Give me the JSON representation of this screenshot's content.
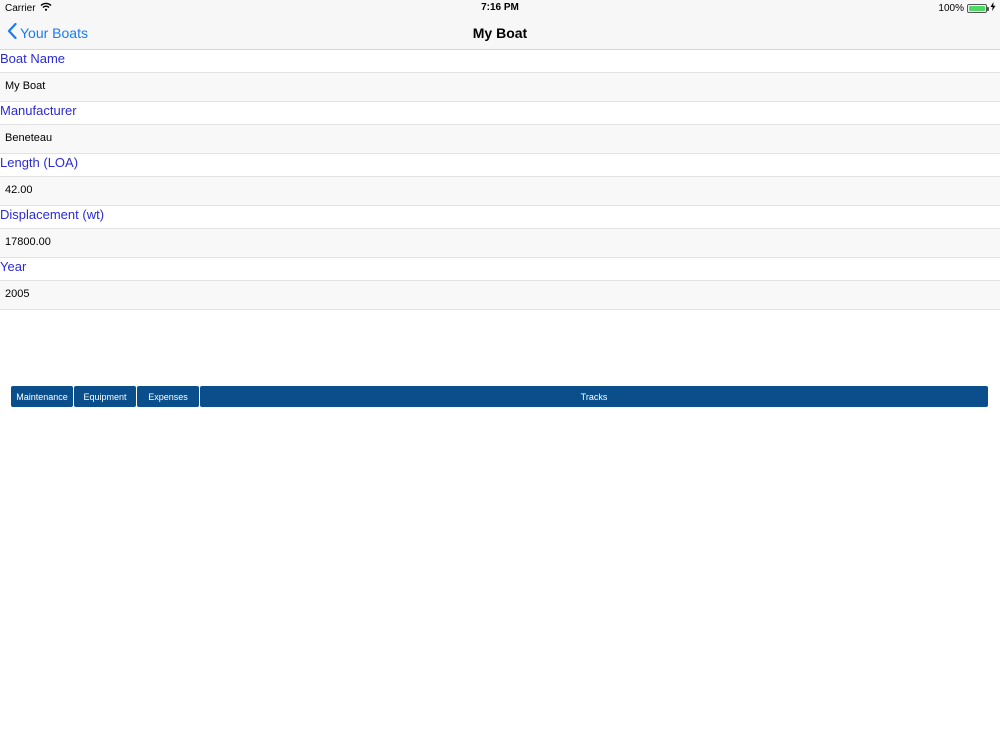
{
  "status_bar": {
    "carrier": "Carrier",
    "time": "7:16 PM",
    "battery_percent": "100%",
    "battery_level": 1.0,
    "battery_color": "#4cd964"
  },
  "nav": {
    "back_label": "Your Boats",
    "title": "My Boat"
  },
  "form": {
    "fields": [
      {
        "label": "Boat Name",
        "value": "My Boat"
      },
      {
        "label": "Manufacturer",
        "value": "Beneteau"
      },
      {
        "label": "Length (LOA)",
        "value": "42.00"
      },
      {
        "label": "Displacement (wt)",
        "value": "17800.00"
      },
      {
        "label": "Year",
        "value": "2005"
      }
    ]
  },
  "tabs": [
    {
      "label": "Maintenance"
    },
    {
      "label": "Equipment"
    },
    {
      "label": "Expenses"
    },
    {
      "label": "Tracks"
    }
  ],
  "colors": {
    "accent": "#1a7bf2",
    "label": "#2b2bd6",
    "tab_background": "#0a4f8c"
  }
}
